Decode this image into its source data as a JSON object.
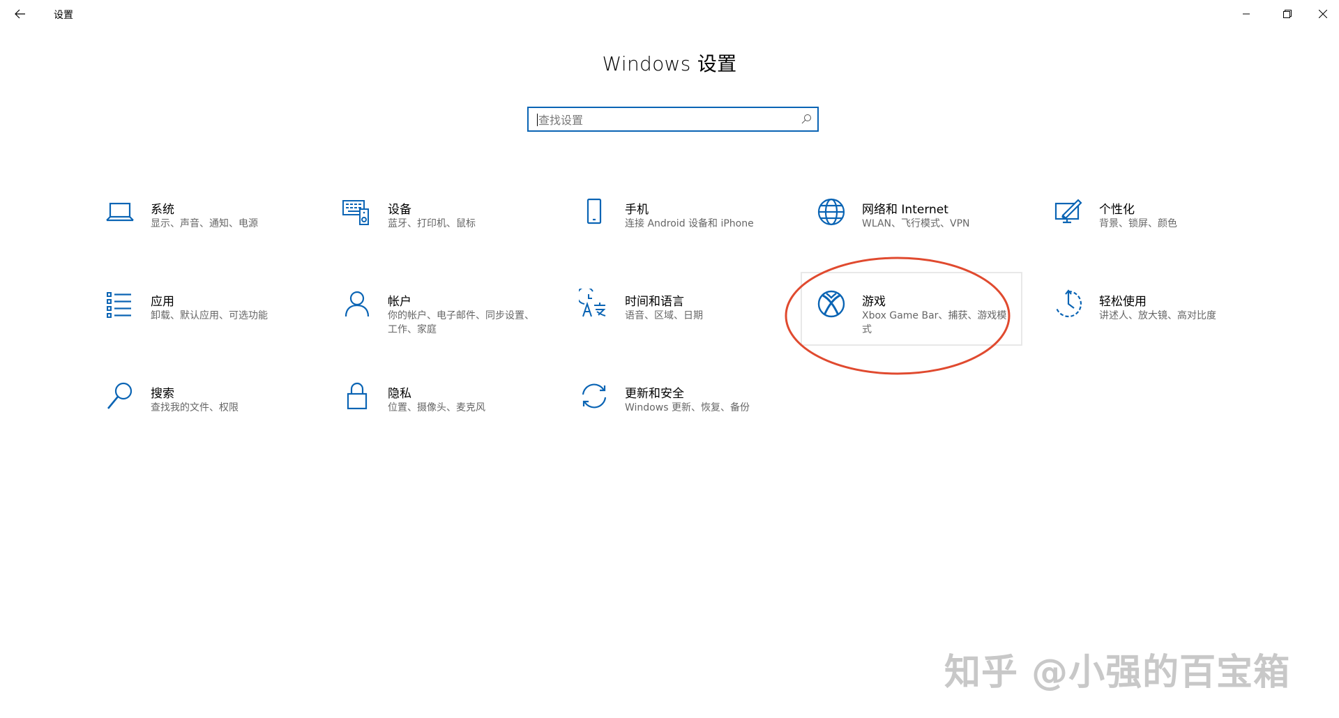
{
  "window": {
    "title": "设置",
    "controls": {
      "minimize": "minimize-icon",
      "maximize": "restore-icon",
      "close": "close-icon"
    }
  },
  "heading": "Windows 设置",
  "search": {
    "placeholder": "查找设置",
    "value": ""
  },
  "accent_color": "#0a64b4",
  "tiles": [
    {
      "title": "系统",
      "desc": "显示、声音、通知、电源",
      "icon": "laptop-icon"
    },
    {
      "title": "设备",
      "desc": "蓝牙、打印机、鼠标",
      "icon": "devices-icon"
    },
    {
      "title": "手机",
      "desc": "连接 Android 设备和 iPhone",
      "icon": "phone-icon"
    },
    {
      "title": "网络和 Internet",
      "desc": "WLAN、飞行模式、VPN",
      "icon": "globe-icon"
    },
    {
      "title": "个性化",
      "desc": "背景、锁屏、颜色",
      "icon": "personalization-icon"
    },
    {
      "title": "应用",
      "desc": "卸载、默认应用、可选功能",
      "icon": "apps-list-icon"
    },
    {
      "title": "帐户",
      "desc": "你的帐户、电子邮件、同步设置、工作、家庭",
      "icon": "person-icon"
    },
    {
      "title": "时间和语言",
      "desc": "语音、区域、日期",
      "icon": "time-language-icon"
    },
    {
      "title": "游戏",
      "desc": "Xbox Game Bar、捕获、游戏模式",
      "icon": "xbox-icon"
    },
    {
      "title": "轻松使用",
      "desc": "讲述人、放大镜、高对比度",
      "icon": "ease-of-access-icon"
    },
    {
      "title": "搜索",
      "desc": "查找我的文件、权限",
      "icon": "search-magnifier-icon"
    },
    {
      "title": "隐私",
      "desc": "位置、摄像头、麦克风",
      "icon": "lock-icon"
    },
    {
      "title": "更新和安全",
      "desc": "Windows 更新、恢复、备份",
      "icon": "sync-icon"
    }
  ],
  "annotation_color": "#e04a2f",
  "watermark": "知乎 @小强的百宝箱"
}
